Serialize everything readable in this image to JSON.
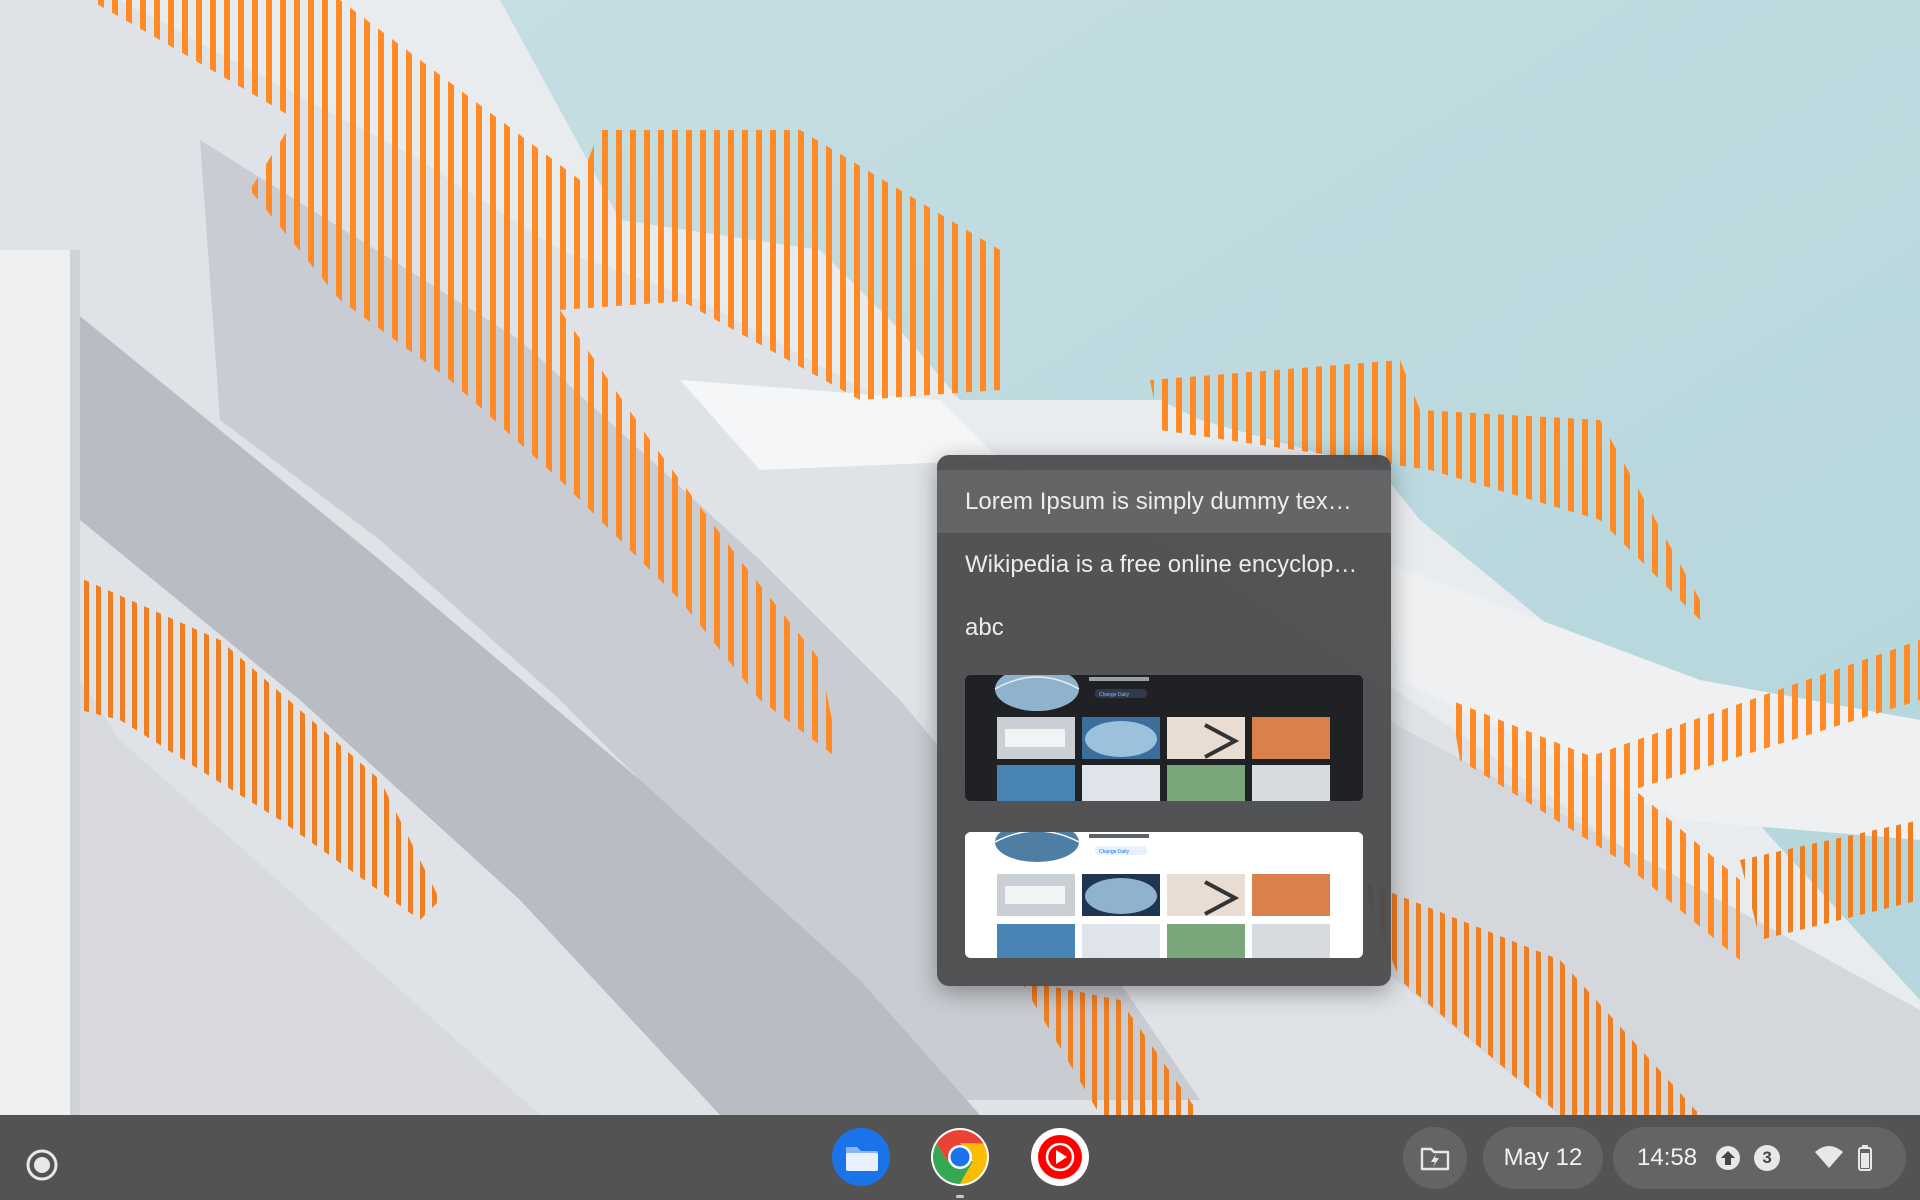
{
  "clipboard": {
    "items": [
      {
        "type": "text",
        "text": "Lorem Ipsum is simply dummy tex…",
        "selected": true
      },
      {
        "type": "text",
        "text": "Wikipedia is a free online encyclop…",
        "selected": false
      },
      {
        "type": "text",
        "text": "abc",
        "selected": false
      },
      {
        "type": "image",
        "theme": "dark",
        "thumbnail_caption": "Photo by Eric McCarty",
        "thumbnail_button": "Change Daily"
      },
      {
        "type": "image",
        "theme": "light",
        "thumbnail_caption": "Photo by Eric McCarty",
        "thumbnail_button": "Change Daily"
      }
    ]
  },
  "shelf": {
    "launcher_icon": "launcher-circle-icon",
    "apps": [
      {
        "name": "Files",
        "icon": "files-folder-icon",
        "color": "#1a73e8"
      },
      {
        "name": "Chrome",
        "icon": "chrome-icon",
        "running": true
      },
      {
        "name": "YouTube Music",
        "icon": "youtube-music-icon",
        "color": "#ff0000"
      }
    ],
    "tray": {
      "holding_space_icon": "holding-space-icon",
      "date": "May 12",
      "time": "14:58",
      "notification_count": "3",
      "wifi_icon": "wifi-icon",
      "battery_icon": "battery-icon",
      "update_icon": "update-arrow-icon"
    }
  },
  "colors": {
    "sky": "#bcd9de",
    "railing": "#ff8c2a",
    "building": "#eef1f3",
    "shelf": "#464648",
    "popup": "#48484a"
  }
}
